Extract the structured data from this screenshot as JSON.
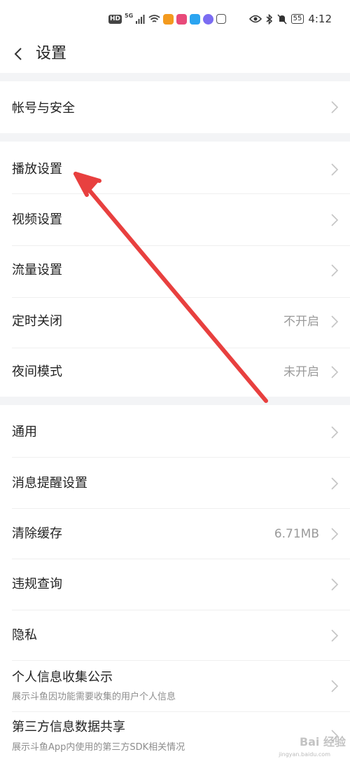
{
  "status_bar": {
    "hd": "HD",
    "net": "5G",
    "battery": "55",
    "time": "4:12",
    "icons": [
      "signal-icon",
      "wifi-icon",
      "orange-app-icon",
      "pink-app-icon",
      "blue-search-app-icon",
      "purple-music-app-icon",
      "gallery-app-icon",
      "eye-icon",
      "bluetooth-icon",
      "mute-icon",
      "battery-icon"
    ]
  },
  "header": {
    "title": "设置",
    "back_icon": "chevron-left-icon"
  },
  "settings": {
    "account": {
      "label": "帐号与安全"
    },
    "playback": {
      "label": "播放设置"
    },
    "video": {
      "label": "视频设置"
    },
    "traffic": {
      "label": "流量设置"
    },
    "timer": {
      "label": "定时关闭",
      "value": "不开启"
    },
    "night": {
      "label": "夜间模式",
      "value": "未开启"
    },
    "general": {
      "label": "通用"
    },
    "notify": {
      "label": "消息提醒设置"
    },
    "cache": {
      "label": "清除缓存",
      "value": "6.71MB"
    },
    "violation": {
      "label": "违规查询"
    },
    "privacy": {
      "label": "隐私"
    },
    "info_collect": {
      "label": "个人信息收集公示",
      "desc": "展示斗鱼因功能需要收集的用户个人信息"
    },
    "third_party": {
      "label": "第三方信息数据共享",
      "desc": "展示斗鱼App内使用的第三方SDK相关情况"
    }
  },
  "watermark": {
    "text": "Bai 经验",
    "sub": "jingyan.baidu.com"
  },
  "colors": {
    "annotation_arrow": "#e8403f",
    "band": "#f3f4f6",
    "value_text": "#9a9a9a"
  }
}
